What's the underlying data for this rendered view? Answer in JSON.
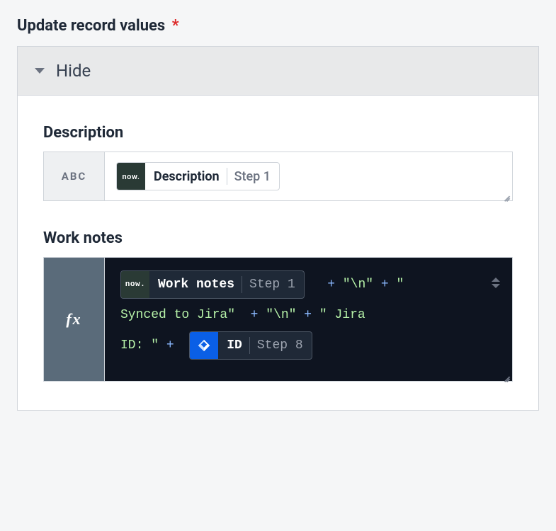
{
  "section": {
    "title": "Update record values",
    "required": "*"
  },
  "panel": {
    "toggle_label": "Hide"
  },
  "fields": {
    "description": {
      "label": "Description",
      "type_badge": "ABC",
      "pill": {
        "logo": "now",
        "name": "Description",
        "step": "Step 1"
      }
    },
    "work_notes": {
      "label": "Work notes",
      "type_badge": "fx",
      "expression": {
        "pill1": {
          "logo": "now",
          "name": "Work notes",
          "step": "Step 1"
        },
        "part1_op1": " + ",
        "part1_str1": "\"\\n\"",
        "part1_op2": " + ",
        "part1_str2": "\" ",
        "part2_str1": "Synced to Jira\"",
        "part2_op1": "  + ",
        "part2_str2": "\"\\n\"",
        "part2_op2": " + ",
        "part2_str3": "\" Jira ",
        "part3_str1": "ID: \"",
        "part3_op1": " + ",
        "pill2": {
          "logo": "jira",
          "name": "ID",
          "step": "Step 8"
        }
      }
    }
  }
}
